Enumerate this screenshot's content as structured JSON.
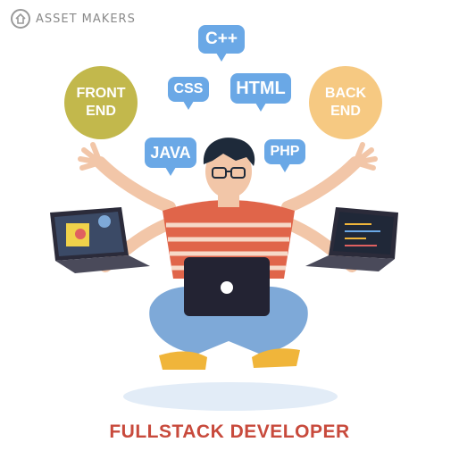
{
  "brand": {
    "name": "ASSET MAKERS",
    "icon": "house-icon"
  },
  "bubbles": {
    "cpp": "C++",
    "css": "CSS",
    "html": "HTML",
    "java": "JAVA",
    "php": "PHP"
  },
  "circles": {
    "front_end": "FRONT END",
    "back_end": "BACK END"
  },
  "title": "FULLSTACK DEVELOPER",
  "colors": {
    "bubble": "#6aa8e6",
    "front_end": "#c2b84c",
    "back_end": "#f6c982",
    "title": "#c84a3c",
    "shirt": "#e0654a",
    "jeans": "#7ea9d8",
    "skin": "#f2c6a8",
    "shoes": "#f0b53a"
  }
}
